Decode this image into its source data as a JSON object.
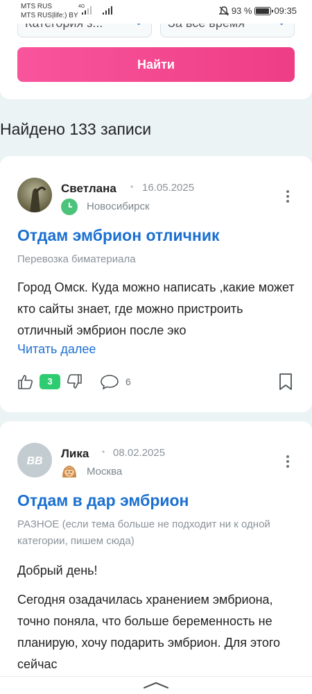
{
  "status_bar": {
    "carrier1": "MTS RUS",
    "carrier2": "MTS RUS|life:) BY",
    "network": "4G",
    "battery": "93 %",
    "time": "09:35"
  },
  "filters": {
    "category_value": "Категория з...",
    "time_value": "За все время",
    "search_button": "Найти"
  },
  "results_heading": "Найдено 133 записи",
  "posts": [
    {
      "author": "Светлана",
      "date": "16.05.2025",
      "city": "Новосибирск",
      "title": "Отдам эмбрион отличник",
      "category": "Перевозка биматериала",
      "body": "Город Омск. Куда можно написать ,какие может кто сайты знает, где можно пристроить отличный эмбрион после эко",
      "read_more": "Читать далее",
      "likes": "3",
      "comments": "6"
    },
    {
      "author": "Лика",
      "avatar_initials": "BB",
      "date": "08.02.2025",
      "city": "Москва",
      "title": "Отдам в дар эмбрион",
      "category": "РАЗНОЕ (если тема больше не подходит ни к одной категории, пишем сюда)",
      "greeting": "Добрый день!",
      "body": "Сегодня озадачилась хранением эмбриона, точно поняла, что больше беременность не планирую, хочу подарить эмбрион. Для этого сейчас"
    }
  ],
  "icons": {
    "like": "thumb-up-icon",
    "dislike": "thumb-down-icon",
    "comment": "comment-bubble-icon",
    "bookmark": "bookmark-icon",
    "more": "kebab-menu-icon",
    "handle": "chevron-up-icon"
  },
  "colors": {
    "accent_pink": "#f04a8f",
    "link_blue": "#1a6fd0",
    "like_green": "#2ecc71",
    "background": "#ebf3f4"
  }
}
